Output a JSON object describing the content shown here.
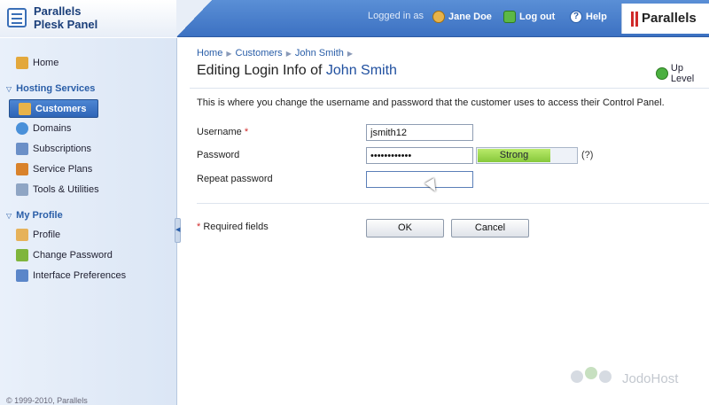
{
  "header": {
    "logo_line1": "Parallels",
    "logo_line2": "Plesk Panel",
    "logged_in_as": "Logged in as",
    "user_name": "Jane Doe",
    "logout_label": "Log out",
    "help_label": "Help",
    "brand_name": "Parallels"
  },
  "sidebar": {
    "home": "Home",
    "section_hosting": "Hosting Services",
    "customers": "Customers",
    "domains": "Domains",
    "subscriptions": "Subscriptions",
    "service_plans": "Service Plans",
    "tools": "Tools & Utilities",
    "section_profile": "My Profile",
    "profile": "Profile",
    "change_password": "Change Password",
    "interface_prefs": "Interface Preferences",
    "copyright": "© 1999-2010, Parallels"
  },
  "main": {
    "breadcrumb": [
      "Home",
      "Customers",
      "John Smith"
    ],
    "title_prefix": "Editing Login Info of ",
    "title_name": "John Smith",
    "up_level": "Up Level",
    "description": "This is where you change the username and password that the customer uses to access their Control Panel.",
    "form": {
      "username_label": "Username",
      "username_value": "jsmith12",
      "password_label": "Password",
      "password_value": "••••••••••••",
      "strength_label": "Strong",
      "strength_fraction": 0.73,
      "strength_hint": "(?)",
      "repeat_label": "Repeat password",
      "repeat_value": "",
      "required_star": "*",
      "required_note": "Required fields",
      "ok_label": "OK",
      "cancel_label": "Cancel"
    }
  },
  "watermark": "JodoHost",
  "colors": {
    "header_blue": "#3c71c2",
    "link_blue": "#2a5ea8",
    "required_red": "#d02a2a",
    "strength_green": "#86c83b"
  }
}
